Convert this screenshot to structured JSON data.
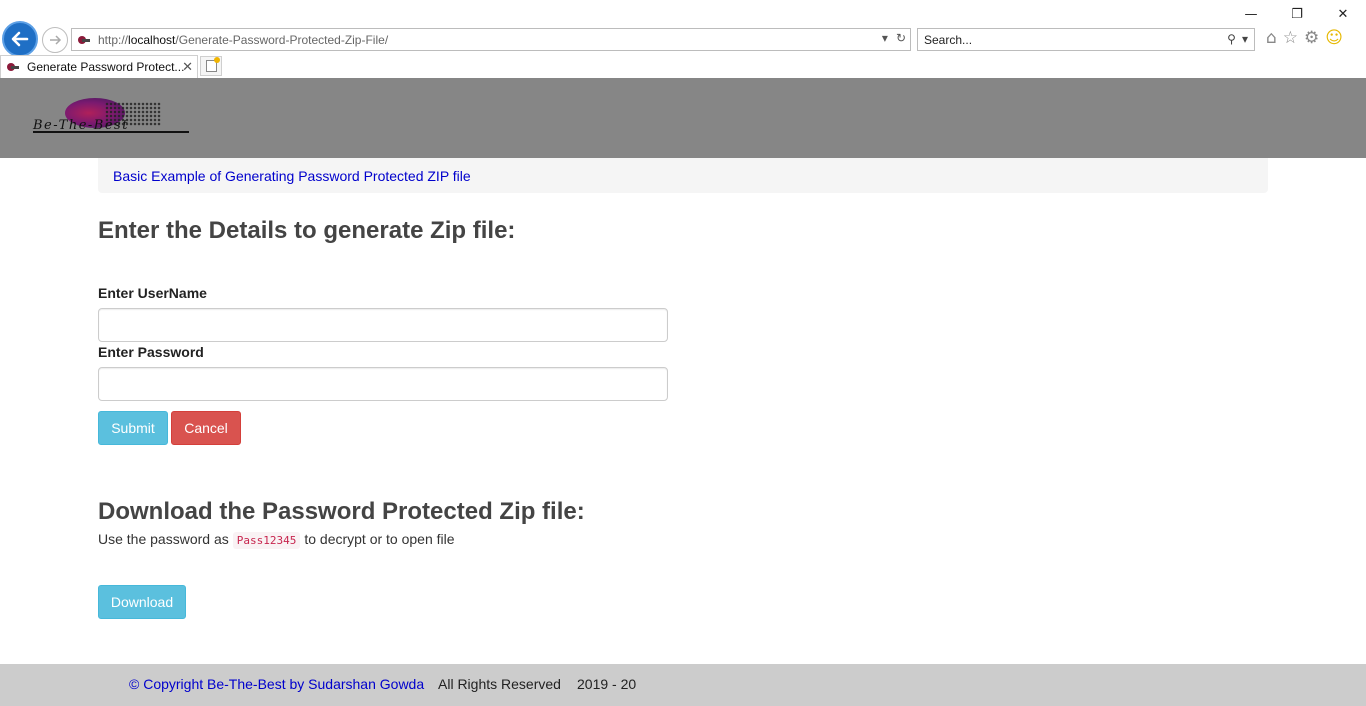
{
  "browser": {
    "url_scheme": "http://",
    "url_host": "localhost",
    "url_path": "/Generate-Password-Protected-Zip-File/",
    "search_placeholder": "Search...",
    "tab_title": "Generate Password Protect..."
  },
  "header": {
    "logo_text": "Be-The-Best"
  },
  "breadcrumb": {
    "link_text": "Basic Example of Generating Password Protected ZIP file"
  },
  "form": {
    "heading": "Enter the Details to generate Zip file:",
    "username_label": "Enter UserName",
    "username_value": "",
    "password_label": "Enter Password",
    "password_value": "",
    "submit_label": "Submit",
    "cancel_label": "Cancel"
  },
  "download": {
    "heading": "Download the Password Protected Zip file:",
    "hint_prefix": "Use the password as",
    "password_code": "Pass12345",
    "hint_suffix": "to decrypt or to open file",
    "button_label": "Download"
  },
  "footer": {
    "copyright": "© Copyright Be-The-Best by Sudarshan Gowda",
    "rights": "All Rights Reserved",
    "years": "2019 - 20"
  },
  "colors": {
    "header_bg": "#868686",
    "btn_info": "#5bc0de",
    "btn_danger": "#d9534f",
    "link": "#0000cc",
    "footer_bg": "#cccccc"
  }
}
